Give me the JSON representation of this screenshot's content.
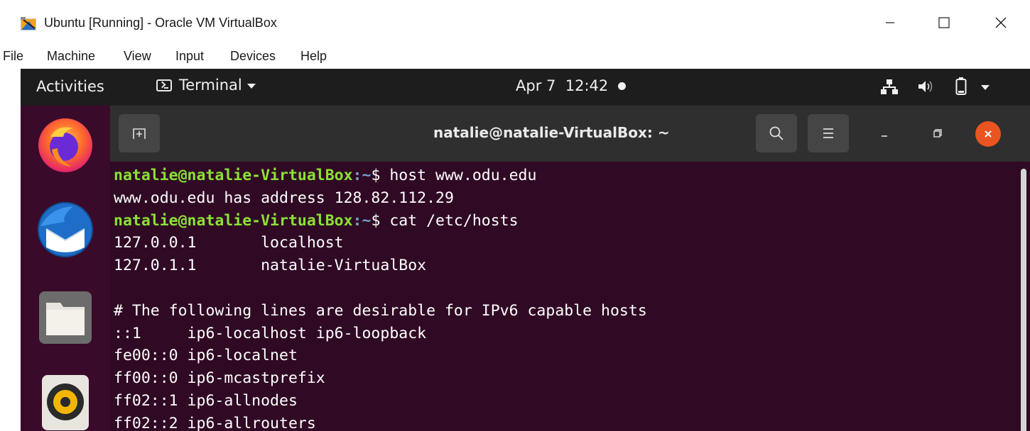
{
  "host_window": {
    "title": "Ubuntu [Running] - Oracle VM VirtualBox",
    "controls": [
      "minimize",
      "maximize",
      "close"
    ]
  },
  "vbox_menu": {
    "items": [
      "File",
      "Machine",
      "View",
      "Input",
      "Devices",
      "Help"
    ]
  },
  "gnome_topbar": {
    "activities": "Activities",
    "app_menu": "Terminal",
    "clock": "Apr 7  12:42",
    "tray_icons": [
      "network-icon",
      "volume-icon",
      "battery-icon",
      "system-menu-caret-icon"
    ]
  },
  "dock": {
    "items": [
      "Firefox",
      "Thunderbird Mail",
      "Files",
      "Rhythmbox"
    ]
  },
  "terminal": {
    "title": "natalie@natalie-VirtualBox: ~",
    "prompt_user": "natalie@natalie-VirtualBox",
    "prompt_path": ":~",
    "prompt_symbol": "$ ",
    "lines": [
      {
        "type": "command",
        "cmd": "host www.odu.edu"
      },
      {
        "type": "output",
        "text": "www.odu.edu has address 128.82.112.29"
      },
      {
        "type": "command",
        "cmd": "cat /etc/hosts"
      },
      {
        "type": "output",
        "text": "127.0.0.1       localhost"
      },
      {
        "type": "output",
        "text": "127.0.1.1       natalie-VirtualBox"
      },
      {
        "type": "output",
        "text": ""
      },
      {
        "type": "output",
        "text": "# The following lines are desirable for IPv6 capable hosts"
      },
      {
        "type": "output",
        "text": "::1     ip6-localhost ip6-loopback"
      },
      {
        "type": "output",
        "text": "fe00::0 ip6-localnet"
      },
      {
        "type": "output",
        "text": "ff00::0 ip6-mcastprefix"
      },
      {
        "type": "output",
        "text": "ff02::1 ip6-allnodes"
      },
      {
        "type": "output",
        "text": "ff02::2 ip6-allrouters"
      }
    ]
  },
  "colors": {
    "terminal_bg": "#300a24",
    "prompt_user": "#8ae234",
    "prompt_path": "#729fcf",
    "close_button": "#e95420",
    "topbar_bg": "#1d1d1d"
  }
}
